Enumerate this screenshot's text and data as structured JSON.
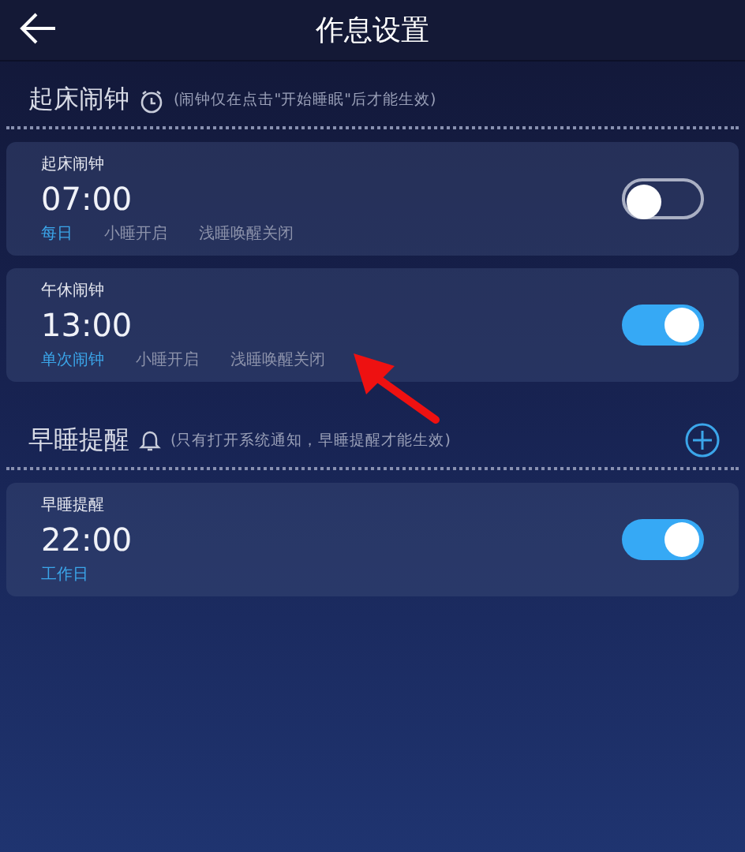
{
  "header": {
    "title": "作息设置"
  },
  "sections": [
    {
      "title": "起床闹钟",
      "kind": "alarm",
      "note": "(闹钟仅在点击\"开始睡眠\"后才能生效)",
      "add_button": false,
      "cards": [
        {
          "name": "起床闹钟",
          "time": "07:00",
          "on": false,
          "tags": [
            {
              "text": "每日",
              "active": true
            },
            {
              "text": "小睡开启",
              "active": false
            },
            {
              "text": "浅睡唤醒关闭",
              "active": false
            }
          ]
        },
        {
          "name": "午休闹钟",
          "time": "13:00",
          "on": true,
          "tags": [
            {
              "text": "单次闹钟",
              "active": true
            },
            {
              "text": "小睡开启",
              "active": false
            },
            {
              "text": "浅睡唤醒关闭",
              "active": false
            }
          ]
        }
      ]
    },
    {
      "title": "早睡提醒",
      "kind": "reminder",
      "note": "(只有打开系统通知，早睡提醒才能生效)",
      "add_button": true,
      "cards": [
        {
          "name": "早睡提醒",
          "time": "22:00",
          "on": true,
          "tags": [
            {
              "text": "工作日",
              "active": true
            }
          ]
        }
      ]
    }
  ]
}
